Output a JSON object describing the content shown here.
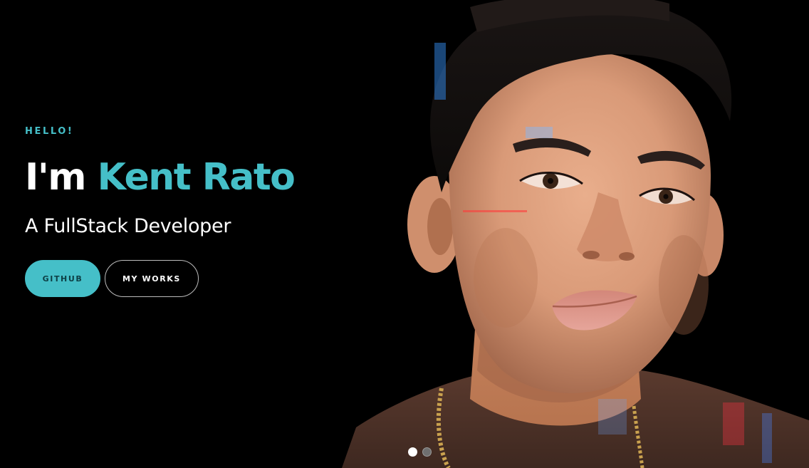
{
  "theme": {
    "accent": "#45bfc8",
    "background": "#000000",
    "text": "#ffffff"
  },
  "hero": {
    "greeting": "HELLO!",
    "headline_prefix": "I'm",
    "name": "Kent Rato",
    "role": "A FullStack Developer",
    "buttons": {
      "github_label": "GITHUB",
      "works_label": "MY WORKS"
    },
    "carousel": {
      "slide_count": 2,
      "active_index": 0
    }
  }
}
